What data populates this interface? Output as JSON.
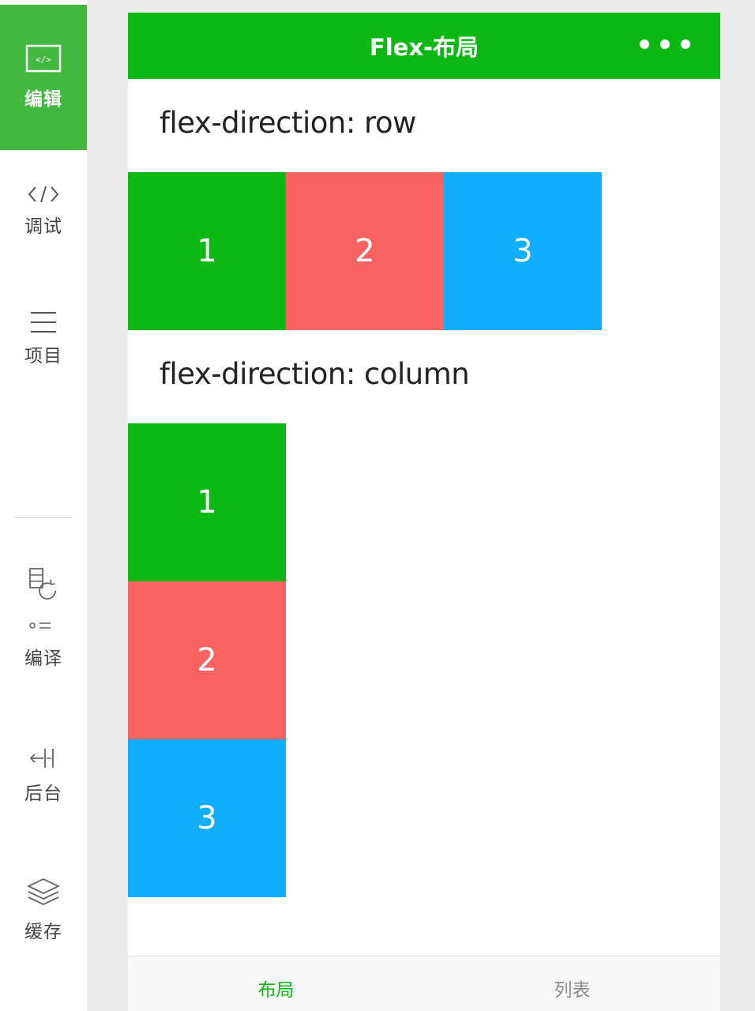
{
  "sidebar": {
    "items": [
      {
        "label": "编辑",
        "icon": "code-window-icon",
        "active": true
      },
      {
        "label": "调试",
        "icon": "code-brackets-icon",
        "active": false
      },
      {
        "label": "项目",
        "icon": "menu-lines-icon",
        "active": false
      },
      {
        "label": "编译",
        "icon": "compile-icon",
        "active": false
      },
      {
        "label": "后台",
        "icon": "background-icon",
        "active": false
      },
      {
        "label": "缓存",
        "icon": "layers-icon",
        "active": false
      }
    ],
    "active_color": "#43b83e"
  },
  "navbar": {
    "title": "Flex-布局",
    "more_icon": "more-dots-icon",
    "color": "#0bb814"
  },
  "sections": {
    "row_title": "flex-direction: row",
    "column_title": "flex-direction: column"
  },
  "row_boxes": [
    {
      "label": "1",
      "color": "#0bb814"
    },
    {
      "label": "2",
      "color": "#f96362"
    },
    {
      "label": "3",
      "color": "#11adff"
    }
  ],
  "column_boxes": [
    {
      "label": "1",
      "color": "#0bb814"
    },
    {
      "label": "2",
      "color": "#f96362"
    },
    {
      "label": "3",
      "color": "#11adff"
    }
  ],
  "tabbar": {
    "tabs": [
      {
        "label": "布局",
        "active": true
      },
      {
        "label": "列表",
        "active": false
      }
    ],
    "active_color": "#0bb814"
  }
}
